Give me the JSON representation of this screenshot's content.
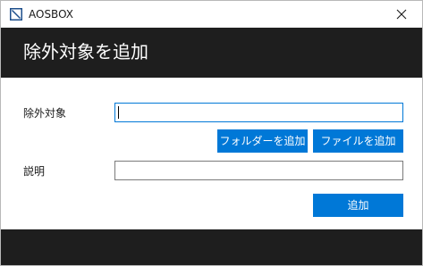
{
  "window": {
    "app_title": "AOSBOX",
    "app_icon": "aosbox-logo-icon",
    "close_icon": "close-icon"
  },
  "header": {
    "title": "除外対象を追加"
  },
  "form": {
    "target_label": "除外対象",
    "target_value": "",
    "add_folder_label": "フォルダーを追加",
    "add_file_label": "ファイルを追加",
    "description_label": "説明",
    "description_value": "",
    "add_label": "追加"
  },
  "colors": {
    "accent": "#0078d7",
    "header_bg": "#1e1e1e",
    "footer_bg": "#1e1e1e"
  }
}
